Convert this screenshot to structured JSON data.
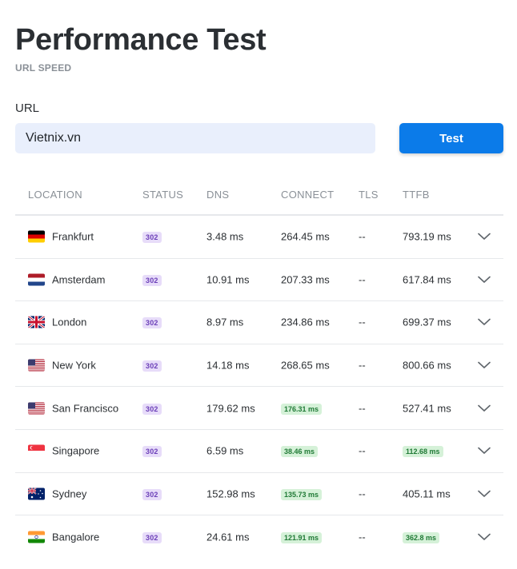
{
  "header": {
    "title": "Performance Test",
    "subtitle": "URL SPEED"
  },
  "form": {
    "url_label": "URL",
    "url_value": "Vietnix.vn",
    "test_button": "Test"
  },
  "table": {
    "columns": [
      "LOCATION",
      "STATUS",
      "DNS",
      "CONNECT",
      "TLS",
      "TTFB"
    ],
    "rows": [
      {
        "location": "Frankfurt",
        "flag": "flag-germany-icon",
        "status": "302",
        "dns": "3.48 ms",
        "connect": "264.45 ms",
        "connect_fast": false,
        "tls": "--",
        "ttfb": "793.19 ms",
        "ttfb_fast": false
      },
      {
        "location": "Amsterdam",
        "flag": "flag-netherlands-icon",
        "status": "302",
        "dns": "10.91 ms",
        "connect": "207.33 ms",
        "connect_fast": false,
        "tls": "--",
        "ttfb": "617.84 ms",
        "ttfb_fast": false
      },
      {
        "location": "London",
        "flag": "flag-uk-icon",
        "status": "302",
        "dns": "8.97 ms",
        "connect": "234.86 ms",
        "connect_fast": false,
        "tls": "--",
        "ttfb": "699.37 ms",
        "ttfb_fast": false
      },
      {
        "location": "New York",
        "flag": "flag-usa-icon",
        "status": "302",
        "dns": "14.18 ms",
        "connect": "268.65 ms",
        "connect_fast": false,
        "tls": "--",
        "ttfb": "800.66 ms",
        "ttfb_fast": false
      },
      {
        "location": "San Francisco",
        "flag": "flag-usa-icon",
        "status": "302",
        "dns": "179.62 ms",
        "connect": "176.31 ms",
        "connect_fast": true,
        "tls": "--",
        "ttfb": "527.41 ms",
        "ttfb_fast": false
      },
      {
        "location": "Singapore",
        "flag": "flag-singapore-icon",
        "status": "302",
        "dns": "6.59 ms",
        "connect": "38.46 ms",
        "connect_fast": true,
        "tls": "--",
        "ttfb": "112.68 ms",
        "ttfb_fast": true
      },
      {
        "location": "Sydney",
        "flag": "flag-australia-icon",
        "status": "302",
        "dns": "152.98 ms",
        "connect": "135.73 ms",
        "connect_fast": true,
        "tls": "--",
        "ttfb": "405.11 ms",
        "ttfb_fast": false
      },
      {
        "location": "Bangalore",
        "flag": "flag-india-icon",
        "status": "302",
        "dns": "24.61 ms",
        "connect": "121.91 ms",
        "connect_fast": true,
        "tls": "--",
        "ttfb": "362.8 ms",
        "ttfb_fast": true
      }
    ]
  },
  "colors": {
    "accent": "#0b7be9",
    "input_bg": "#e9effc",
    "status_badge_bg": "#e7dcf9",
    "status_badge_fg": "#6b3fb8",
    "fast_badge_bg": "#d5f1d8",
    "fast_badge_fg": "#207a36"
  }
}
